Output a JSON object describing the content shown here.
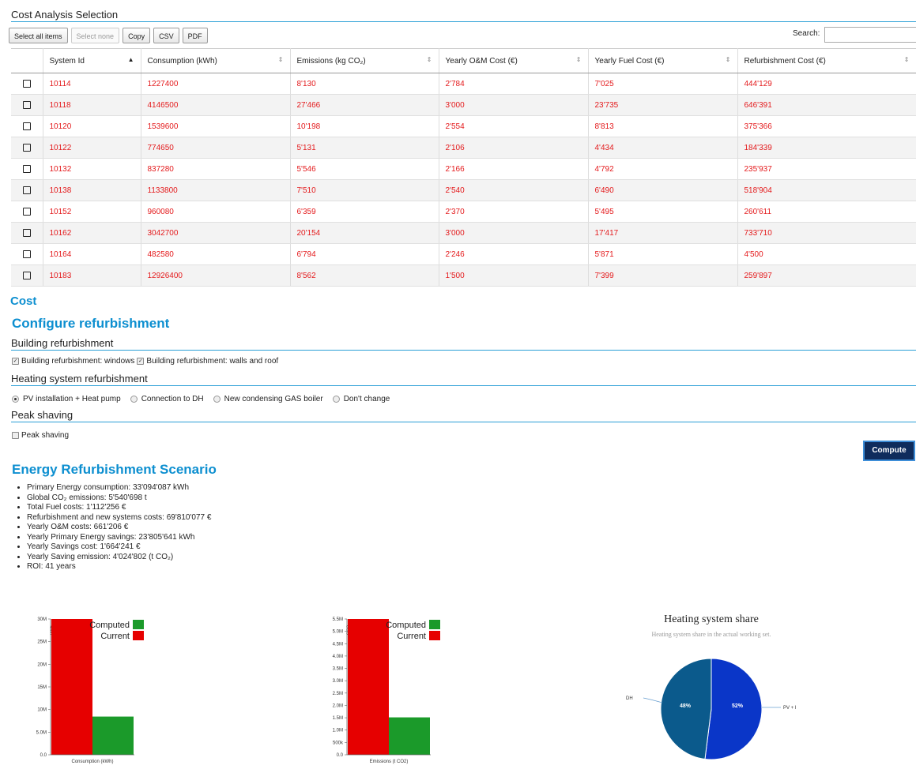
{
  "title": "Cost Analysis Selection",
  "toolbar": {
    "select_all": "Select all items",
    "select_none": "Select none",
    "copy": "Copy",
    "csv": "CSV",
    "pdf": "PDF",
    "search_label": "Search:",
    "search_value": ""
  },
  "table": {
    "columns": [
      "System Id",
      "Consumption (kWh)",
      "Emissions (kg CO₂)",
      "Yearly O&M Cost (€)",
      "Yearly Fuel Cost (€)",
      "Refurbishment Cost (€)"
    ],
    "rows": [
      [
        "10114",
        "1227400",
        "8'130",
        "2'784",
        "7'025",
        "444'129"
      ],
      [
        "10118",
        "4146500",
        "27'466",
        "3'000",
        "23'735",
        "646'391"
      ],
      [
        "10120",
        "1539600",
        "10'198",
        "2'554",
        "8'813",
        "375'366"
      ],
      [
        "10122",
        "774650",
        "5'131",
        "2'106",
        "4'434",
        "184'339"
      ],
      [
        "10132",
        "837280",
        "5'546",
        "2'166",
        "4'792",
        "235'937"
      ],
      [
        "10138",
        "1133800",
        "7'510",
        "2'540",
        "6'490",
        "518'904"
      ],
      [
        "10152",
        "960080",
        "6'359",
        "2'370",
        "5'495",
        "260'611"
      ],
      [
        "10162",
        "3042700",
        "20'154",
        "3'000",
        "17'417",
        "733'710"
      ],
      [
        "10164",
        "482580",
        "6'794",
        "2'246",
        "5'871",
        "4'500"
      ],
      [
        "10183",
        "12926400",
        "8'562",
        "1'500",
        "7'399",
        "259'897"
      ]
    ],
    "data_color": "#e41a1c"
  },
  "cost_heading": "Cost",
  "configure_heading": "Configure refurbishment",
  "building": {
    "title": "Building refurbishment",
    "opt_windows": "Building refurbishment: windows",
    "opt_walls": "Building refurbishment: walls and roof"
  },
  "heating": {
    "title": "Heating system refurbishment",
    "options": [
      "PV installation + Heat pump",
      "Connection to DH",
      "New condensing GAS boiler",
      "Don't change"
    ],
    "selected": "PV installation + Heat pump"
  },
  "peak": {
    "title": "Peak shaving",
    "opt": "Peak shaving"
  },
  "compute_label": "Compute",
  "scenario": {
    "title": "Energy Refurbishment Scenario",
    "items": [
      "Primary Energy consumption: 33'094'087 kWh",
      "Global CO₂ emissions: 5'540'698 t",
      "Total Fuel costs: 1'112'256 €",
      "Refurbishment and new systems costs: 69'810'077 €",
      "Yearly O&M costs: 661'206 €",
      "Yearly Primary Energy savings: 23'805'641 kWh",
      "Yearly Savings cost: 1'664'241 €",
      "Yearly Saving emission: 4'024'802 (t CO₂)",
      "ROI: 41 years"
    ]
  },
  "colors": {
    "current": "#e60000",
    "computed": "#1b9a2a",
    "accent": "#0d8fd0",
    "pie_dh": "#0b5a8c",
    "pie_pv": "#0a36c8"
  },
  "chart_data": [
    {
      "type": "bar",
      "xlabel": "Consumption (kWh)",
      "ylabel": "kWh",
      "categories": [
        "Current",
        "Computed"
      ],
      "values": [
        33094087,
        9288446
      ],
      "ylim": [
        0,
        33000000
      ],
      "ticks": [
        "0.0",
        "5.0M",
        "10M",
        "15M",
        "20M",
        "25M",
        "30M"
      ],
      "legend": [
        "Computed",
        "Current"
      ]
    },
    {
      "type": "bar",
      "xlabel": "Emissions (t CO2)",
      "ylabel": "CO2",
      "categories": [
        "Current",
        "Computed"
      ],
      "values": [
        5540698,
        1515896
      ],
      "ylim": [
        0,
        5500000
      ],
      "ticks": [
        "0.0",
        "500k",
        "1.0M",
        "1.5M",
        "2.0M",
        "2.5M",
        "3.0M",
        "3.5M",
        "4.0M",
        "4.5M",
        "5.0M",
        "5.5M"
      ],
      "legend": [
        "Computed",
        "Current"
      ]
    },
    {
      "type": "pie",
      "title": "Heating system share",
      "subtitle": "Heating system share in the actual working set.",
      "slices": [
        {
          "label": "DH",
          "value": 48,
          "text": "48%"
        },
        {
          "label": "PV + I",
          "value": 52,
          "text": "52%"
        }
      ]
    }
  ]
}
